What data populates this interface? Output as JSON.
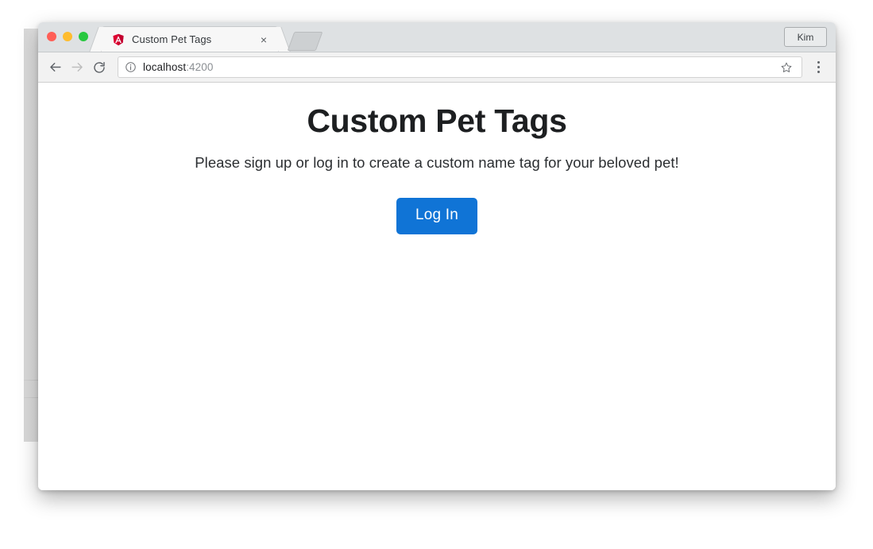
{
  "browser": {
    "window_controls": [
      {
        "name": "close",
        "color": "#ff5f57"
      },
      {
        "name": "minimize",
        "color": "#febc2e"
      },
      {
        "name": "maximize",
        "color": "#28c840"
      }
    ],
    "tabs": [
      {
        "title": "Custom Pet Tags",
        "favicon": "angular-icon",
        "close_label": "×",
        "active": true
      }
    ],
    "new_tab_label": "",
    "profile_label": "Kim",
    "toolbar": {
      "back_icon": "back-arrow-icon",
      "forward_icon": "forward-arrow-icon",
      "reload_icon": "reload-icon",
      "info_icon": "info-circle-icon",
      "url_host": "localhost",
      "url_port": ":4200",
      "bookmark_icon": "star-icon",
      "menu_icon": "three-dot-menu-icon"
    }
  },
  "page": {
    "title": "Custom Pet Tags",
    "subtitle": "Please sign up or log in to create a custom name tag for your beloved pet!",
    "login_button": "Log In"
  },
  "colors": {
    "accent_blue": "#1074d6",
    "tabstrip_bg": "#dee1e3",
    "toolbar_bg": "#f2f2f2",
    "page_bg": "#ffffff",
    "angular_red": "#dd0031"
  }
}
